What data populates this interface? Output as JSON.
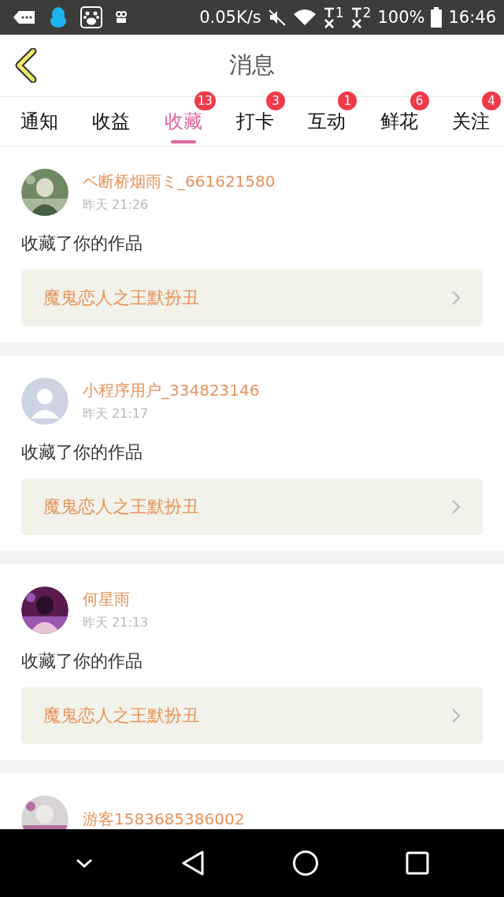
{
  "status_bar": {
    "speed": "0.05K/s",
    "sim_1": "1",
    "sim_2": "2",
    "battery": "100%",
    "time": "16:46"
  },
  "header": {
    "title": "消息"
  },
  "tabs": [
    {
      "label": "通知",
      "selected": false
    },
    {
      "label": "收益",
      "selected": false
    },
    {
      "label": "收藏",
      "selected": true,
      "badge": "13"
    },
    {
      "label": "打卡",
      "selected": false,
      "badge": "3"
    },
    {
      "label": "互动",
      "selected": false,
      "badge": "1"
    },
    {
      "label": "鲜花",
      "selected": false,
      "badge": "6"
    },
    {
      "label": "关注",
      "selected": false,
      "badge": "4"
    }
  ],
  "messages": [
    {
      "user": "ベ断桥烟雨ミ_661621580",
      "time": "昨天 21:26",
      "text": "收藏了你的作品",
      "work": "魔鬼恋人之王默扮丑"
    },
    {
      "avatar": {
        "kind": "silhouette"
      },
      "user": "小程序用户_334823146",
      "time": "昨天 21:17",
      "text": "收藏了你的作品",
      "work": "魔鬼恋人之王默扮丑"
    },
    {
      "user": "何星雨",
      "time": "昨天 21:13",
      "text": "收藏了你的作品",
      "work": "魔鬼恋人之王默扮丑"
    },
    {
      "user": "游客1583685386002"
    }
  ]
}
